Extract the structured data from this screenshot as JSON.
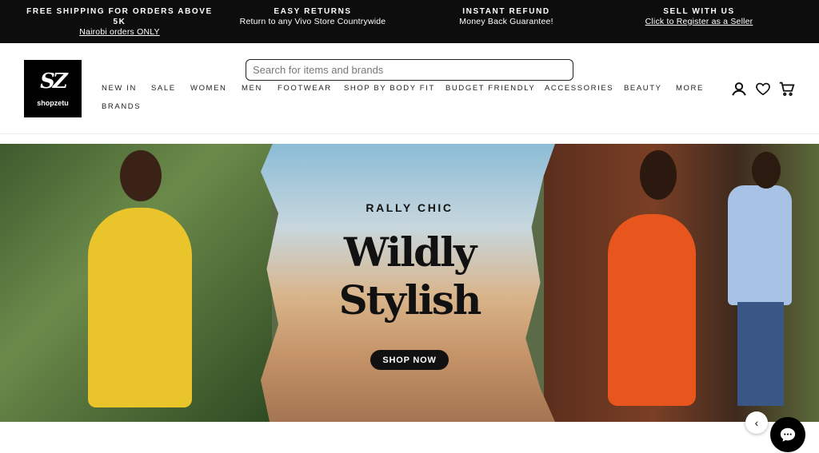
{
  "announcements": [
    {
      "heading": "FREE SHIPPING FOR ORDERS ABOVE 5K",
      "sub": "Nairobi orders ONLY"
    },
    {
      "heading": "EASY RETURNS",
      "sub": "Return to any Vivo Store Countrywide"
    },
    {
      "heading": "INSTANT REFUND",
      "sub": "Money Back Guarantee!"
    },
    {
      "heading": "SELL WITH US",
      "sub": "Click to Register as a Seller"
    }
  ],
  "logo": {
    "mark": "SZ",
    "wordmark": "shopzetu"
  },
  "search": {
    "placeholder": "Search for items and brands"
  },
  "nav": [
    "NEW IN",
    "SALE",
    "WOMEN",
    "MEN",
    "FOOTWEAR",
    "SHOP BY BODY FIT",
    "BUDGET FRIENDLY",
    "ACCESSORIES",
    "BEAUTY",
    "MORE",
    "BRANDS"
  ],
  "icons": {
    "account": "account-icon",
    "wishlist": "heart-icon",
    "cart": "cart-icon",
    "prev": "chevron-left-icon",
    "chat": "chat-icon"
  },
  "hero": {
    "eyebrow": "RALLY CHIC",
    "headline_line1": "Wildly",
    "headline_line2": "Stylish",
    "cta": "SHOP NOW",
    "prev_glyph": "‹"
  },
  "colors": {
    "topbar": "#0d0d0d",
    "accent": "#111111"
  }
}
